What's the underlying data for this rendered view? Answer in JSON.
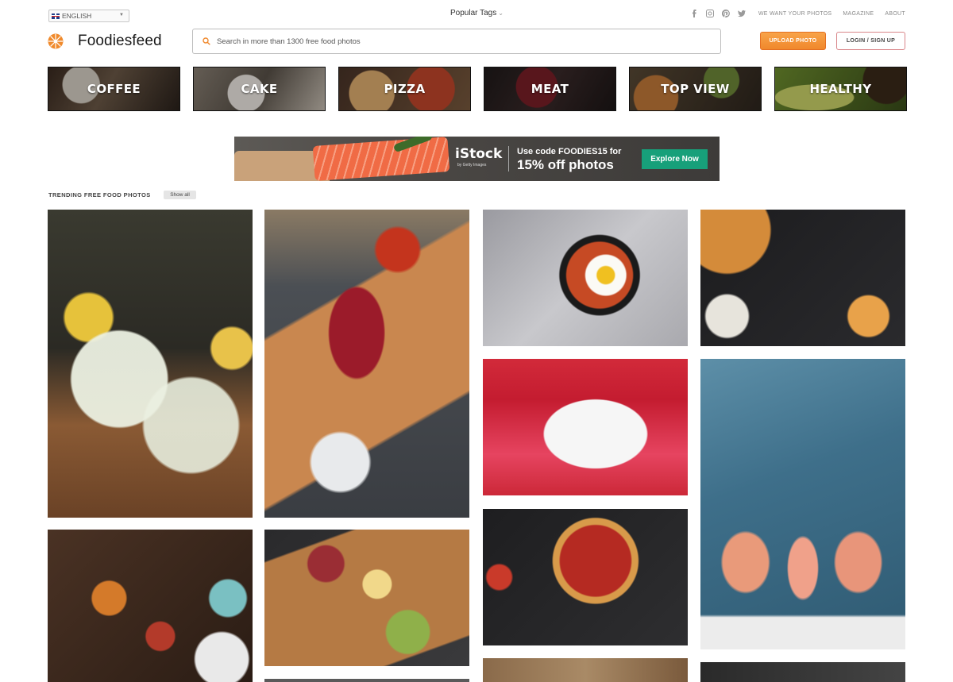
{
  "top_bar": {
    "language": "ENGLISH",
    "popular_tags": "Popular Tags",
    "social_icons": [
      "facebook-icon",
      "instagram-icon",
      "pinterest-icon",
      "twitter-icon"
    ],
    "links": [
      "WE WANT YOUR PHOTOS",
      "MAGAZINE",
      "ABOUT"
    ]
  },
  "header": {
    "brand": "Foodiesfeed",
    "search_placeholder": "Search in more than 1300 free food photos",
    "upload_label": "UPLOAD PHOTO",
    "login_label": "LOGIN / SIGN UP"
  },
  "categories": [
    "COFFEE",
    "CAKE",
    "PIZZA",
    "MEAT",
    "TOP VIEW",
    "HEALTHY"
  ],
  "ad": {
    "brand": "iStock",
    "brand_sub": "by Getty Images",
    "line1": "Use code FOODIES15 for",
    "line2": "15% off photos",
    "cta": "Explore Now"
  },
  "trending": {
    "title": "TRENDING FREE FOOD PHOTOS",
    "show_all": "Show all"
  },
  "colors": {
    "accent_orange": "#f0882c",
    "login_border": "#d9868a",
    "ad_cta": "#17a07a"
  }
}
